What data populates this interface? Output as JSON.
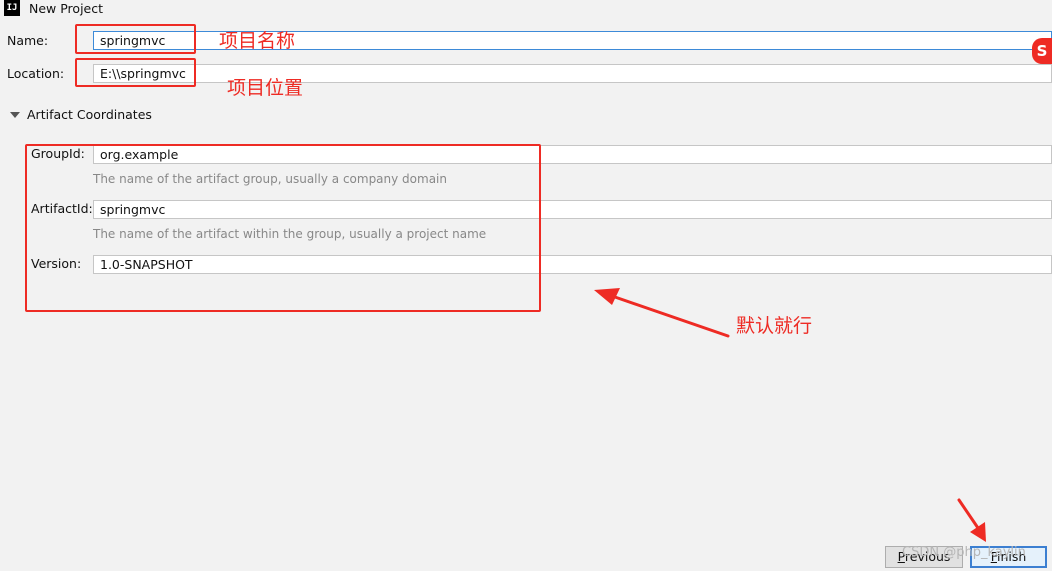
{
  "window": {
    "title": "New Project",
    "app_icon": "IJ"
  },
  "form": {
    "name_label": "Name:",
    "name_value": "springmvc",
    "location_label": "Location:",
    "location_value": "E:\\\\springmvc",
    "section_title": "Artifact Coordinates",
    "groupid_label": "GroupId:",
    "groupid_value": "org.example",
    "groupid_hint": "The name of the artifact group, usually a company domain",
    "artifactid_label": "ArtifactId:",
    "artifactid_value": "springmvc",
    "artifactid_hint": "The name of the artifact within the group, usually a project name",
    "version_label": "Version:",
    "version_value": "1.0-SNAPSHOT"
  },
  "annotations": {
    "project_name": "项目名称",
    "project_location": "项目位置",
    "default_ok": "默认就行",
    "color": "#ee2b24"
  },
  "buttons": {
    "previous_mnemonic": "P",
    "previous_rest": "revious",
    "finish_mnemonic": "F",
    "finish_rest": "inish"
  },
  "watermark": "CSDN @php_kaylin",
  "colors": {
    "focus_border": "#3d8ad8",
    "primary_button_border": "#3c7fd1"
  },
  "icons": [
    "intellij-app-icon",
    "collapse-triangle-icon",
    "sogou-ime-icon"
  ]
}
